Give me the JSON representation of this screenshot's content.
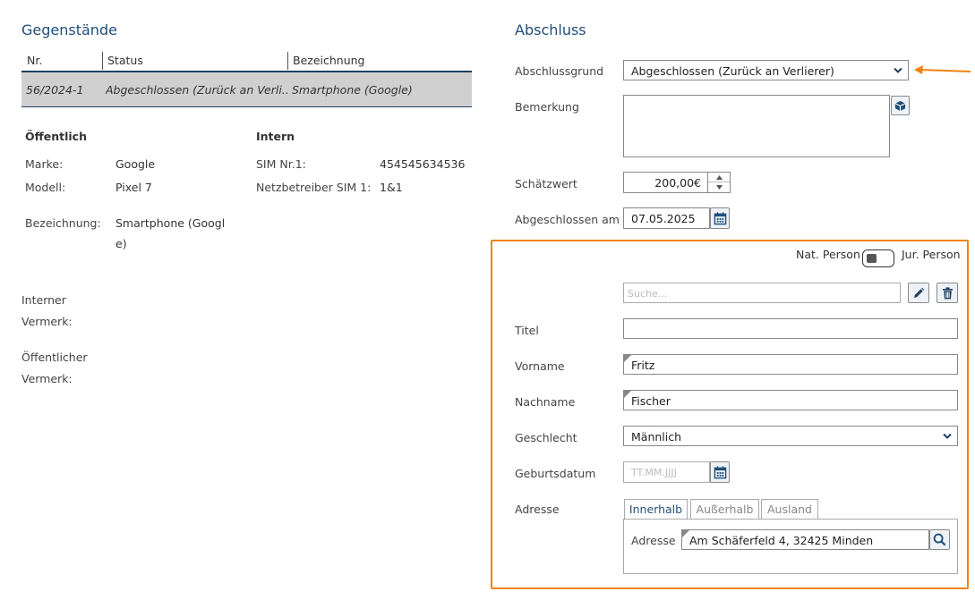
{
  "left": {
    "title": "Gegenstände",
    "table": {
      "headers": [
        "Nr.",
        "Status",
        "Bezeichnung"
      ],
      "rows": [
        {
          "nr": "56/2024-1",
          "status": "Abgeschlossen (Zurück an Verli...",
          "bezeichnung": "Smartphone (Google)"
        }
      ]
    },
    "oeffentlich": {
      "heading": "Öffentlich",
      "marke_label": "Marke:",
      "marke": "Google",
      "modell_label": "Modell:",
      "modell": "Pixel 7",
      "bezeichnung_label": "Bezeichnung:",
      "bezeichnung_line1": "Smartphone (Googl",
      "bezeichnung_line2": "e)"
    },
    "intern": {
      "heading": "Intern",
      "sim_label": "SIM Nr.1:",
      "sim": "454545634536",
      "netz_label": "Netzbetreiber SIM 1:",
      "netz": "1&1"
    },
    "interner_vermerk": {
      "line1": "Interner",
      "line2": "Vermerk:"
    },
    "oeffentlicher_vermerk": {
      "line1": "Öffentlicher",
      "line2": "Vermerk:"
    }
  },
  "right": {
    "title": "Abschluss",
    "abschlussgrund_label": "Abschlussgrund",
    "abschlussgrund_value": "Abgeschlossen (Zurück an Verlierer)",
    "bemerkung_label": "Bemerkung",
    "bemerkung_value": "",
    "schaetzwert_label": "Schätzwert",
    "schaetzwert_value": "200,00€",
    "abgeschlossen_am_label": "Abgeschlossen am",
    "abgeschlossen_am_value": "07.05.2025",
    "person": {
      "nat_label": "Nat. Person",
      "jur_label": "Jur. Person",
      "search_placeholder": "Suche...",
      "titel_label": "Titel",
      "titel_value": "",
      "vorname_label": "Vorname",
      "vorname_value": "Fritz",
      "nachname_label": "Nachname",
      "nachname_value": "Fischer",
      "geschlecht_label": "Geschlecht",
      "geschlecht_value": "Männlich",
      "geburtsdatum_label": "Geburtsdatum",
      "geburtsdatum_placeholder": "TT.MM.JJJJ",
      "adresse_label": "Adresse",
      "tabs": [
        "Innerhalb",
        "Außerhalb",
        "Ausland"
      ],
      "adresse_inner_label": "Adresse",
      "adresse_value": "Am Schäferfeld 4, 32425 Minden"
    }
  },
  "colors": {
    "accent": "#f0820f",
    "title": "#1f4e79",
    "row_bg": "#d0d0d0"
  }
}
